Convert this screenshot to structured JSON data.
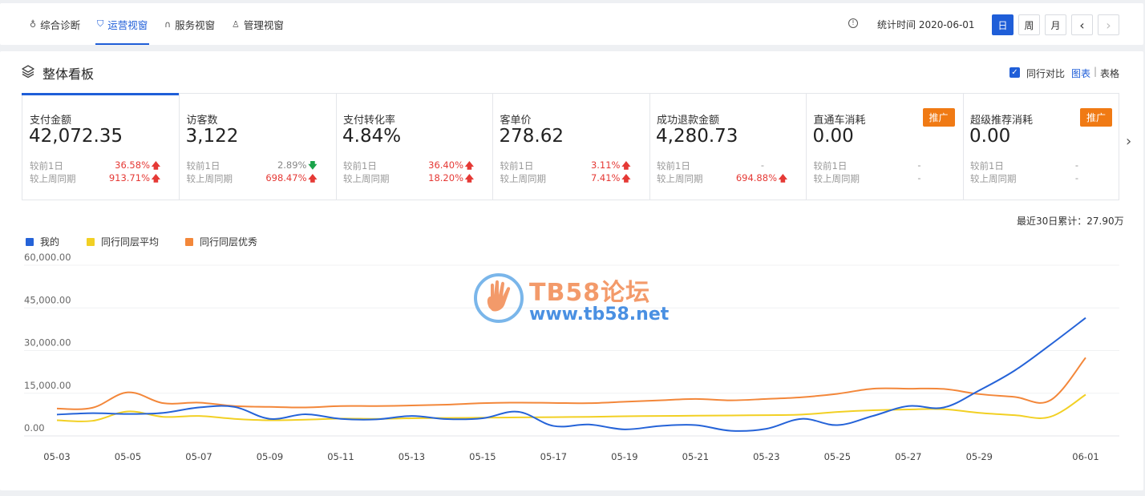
{
  "tabs": [
    {
      "label": "综合诊断",
      "icon": "bulb-icon",
      "active": false
    },
    {
      "label": "运营视窗",
      "icon": "shield-icon",
      "active": true
    },
    {
      "label": "服务视窗",
      "icon": "headset-icon",
      "active": false
    },
    {
      "label": "管理视窗",
      "icon": "medal-icon",
      "active": false
    }
  ],
  "header": {
    "stat_time": "统计时间 2020-06-01",
    "range_day": "日",
    "range_week": "周",
    "range_month": "月",
    "prev": "‹",
    "next": "›"
  },
  "panel": {
    "title": "整体看板",
    "compare_label": "同行对比",
    "view_chart": "图表",
    "view_sep": "|",
    "view_table": "表格"
  },
  "cards": [
    {
      "name": "支付金额",
      "value": "42,072.35",
      "r1_label": "较前1日",
      "r1_value": "36.58%",
      "r1_dir": "up",
      "r2_label": "较上周同期",
      "r2_value": "913.71%",
      "r2_dir": "up"
    },
    {
      "name": "访客数",
      "value": "3,122",
      "r1_label": "较前1日",
      "r1_value": "2.89%",
      "r1_dir": "down",
      "r2_label": "较上周同期",
      "r2_value": "698.47%",
      "r2_dir": "up"
    },
    {
      "name": "支付转化率",
      "value": "4.84%",
      "r1_label": "较前1日",
      "r1_value": "36.40%",
      "r1_dir": "up",
      "r2_label": "较上周同期",
      "r2_value": "18.20%",
      "r2_dir": "up"
    },
    {
      "name": "客单价",
      "value": "278.62",
      "r1_label": "较前1日",
      "r1_value": "3.11%",
      "r1_dir": "up",
      "r2_label": "较上周同期",
      "r2_value": "7.41%",
      "r2_dir": "up"
    },
    {
      "name": "成功退款金额",
      "value": "4,280.73",
      "r1_label": "较前1日",
      "r1_value": "-",
      "r1_dir": "none",
      "r2_label": "较上周同期",
      "r2_value": "694.88%",
      "r2_dir": "up"
    },
    {
      "name": "直通车消耗",
      "value": "0.00",
      "r1_label": "较前1日",
      "r1_value": "-",
      "r1_dir": "none",
      "r2_label": "较上周同期",
      "r2_value": "-",
      "r2_dir": "none",
      "promo": "推广"
    },
    {
      "name": "超级推荐消耗",
      "value": "0.00",
      "r1_label": "较前1日",
      "r1_value": "-",
      "r1_dir": "none",
      "r2_label": "较上周同期",
      "r2_value": "-",
      "r2_dir": "none",
      "promo": "推广"
    }
  ],
  "accum_text": "最近30日累计：27.90万",
  "watermark": {
    "line1": "TB58论坛",
    "line2": "www.tb58.net"
  },
  "colors": {
    "accent": "#1f5ed8",
    "mine": "#2563d8",
    "avg": "#f2d024",
    "best": "#f3873a",
    "up": "#e53935",
    "down": "#1aa34a",
    "promo": "#f07a14"
  },
  "chart_data": {
    "type": "line",
    "x": [
      "05-03",
      "05-04",
      "05-05",
      "05-06",
      "05-07",
      "05-08",
      "05-09",
      "05-10",
      "05-11",
      "05-12",
      "05-13",
      "05-14",
      "05-15",
      "05-16",
      "05-17",
      "05-18",
      "05-19",
      "05-20",
      "05-21",
      "05-22",
      "05-23",
      "05-24",
      "05-25",
      "05-26",
      "05-27",
      "05-28",
      "05-29",
      "05-30",
      "05-31",
      "06-01"
    ],
    "tick_labels": [
      "05-03",
      "05-05",
      "05-07",
      "05-09",
      "05-11",
      "05-13",
      "05-15",
      "05-17",
      "05-19",
      "05-21",
      "05-23",
      "05-25",
      "05-27",
      "05-29",
      "06-01"
    ],
    "y_ticks": [
      "60,000.00",
      "45,000.00",
      "30,000.00",
      "15,000.00",
      "0.00"
    ],
    "ylim": [
      0,
      60000
    ],
    "legend_position": "top-left",
    "grid": true,
    "series": [
      {
        "name": "我的",
        "color": "#2563d8",
        "values": [
          7500,
          8000,
          7700,
          8100,
          10000,
          10200,
          6000,
          7600,
          6000,
          5800,
          7000,
          5900,
          6200,
          8500,
          3500,
          4000,
          2300,
          3500,
          3800,
          1800,
          2500,
          6000,
          3800,
          7000,
          10500,
          10000,
          16000,
          23000,
          32000,
          41500
        ]
      },
      {
        "name": "同行同层平均",
        "color": "#f2d024",
        "values": [
          5500,
          5300,
          8600,
          6700,
          7000,
          6000,
          5500,
          5700,
          6100,
          6000,
          6200,
          6300,
          6400,
          6500,
          6600,
          6700,
          6900,
          7000,
          7100,
          7200,
          7300,
          7500,
          8400,
          9000,
          9300,
          9400,
          8100,
          7300,
          6700,
          14500
        ]
      },
      {
        "name": "同行同层优秀",
        "color": "#f3873a",
        "values": [
          9600,
          9900,
          15300,
          11500,
          11700,
          10500,
          10200,
          10000,
          10500,
          10500,
          10700,
          11000,
          11500,
          11700,
          11600,
          11500,
          12000,
          12500,
          13000,
          12500,
          13000,
          13600,
          14800,
          16600,
          16600,
          16500,
          14700,
          13700,
          12500,
          27500
        ]
      }
    ]
  }
}
